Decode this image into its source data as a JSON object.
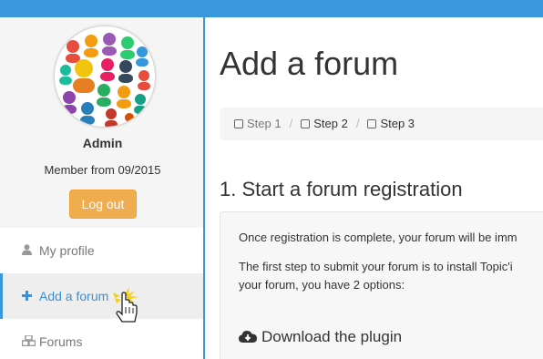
{
  "sidebar": {
    "user_name": "Admin",
    "member_from": "Member from 09/2015",
    "logout_label": "Log out",
    "nav": [
      {
        "label": "My profile",
        "icon": "user-icon"
      },
      {
        "label": "Add a forum",
        "icon": "plus-icon",
        "active": true
      },
      {
        "label": "Forums",
        "icon": "cubes-icon"
      }
    ]
  },
  "main": {
    "page_title": "Add a forum",
    "steps": [
      "Step 1",
      "Step 2",
      "Step 3"
    ],
    "section_title": "1. Start a forum registration",
    "panel": {
      "line1": "Once registration is complete, your forum will be imm",
      "line2": "The first step to submit your forum is to install Topic'i",
      "line3": "your forum, you have 2 options:",
      "download_label": "Download the plugin"
    }
  },
  "colors": {
    "accent": "#3a96dd",
    "logout": "#f0ad4e",
    "link": "#3a8fd6"
  }
}
